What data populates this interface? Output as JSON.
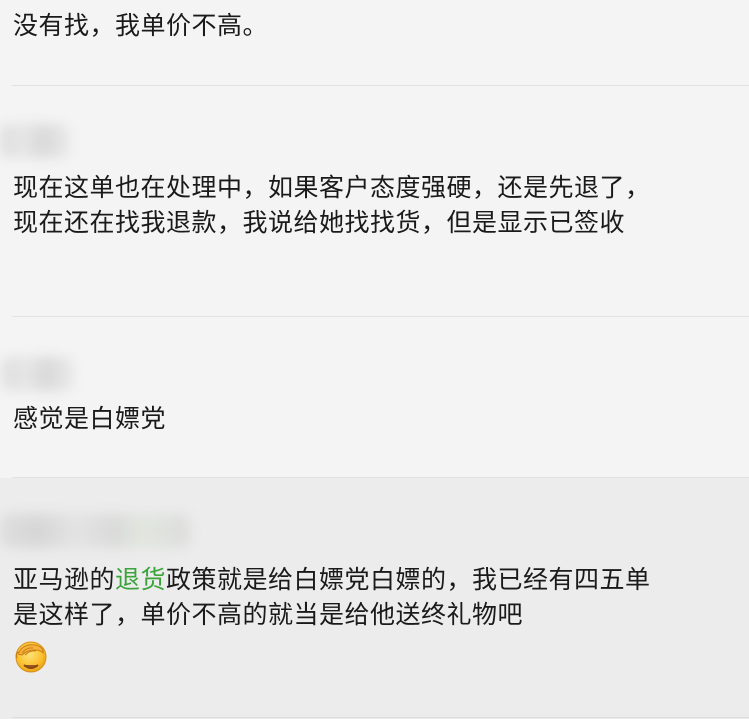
{
  "comments": [
    {
      "text": "没有找，我单价不高。"
    },
    {
      "text": "现在这单也在处理中，如果客户态度强硬，还是先退了，现在还在找我退款，我说给她找找货，但是显示已签收"
    },
    {
      "text": "感觉是白嫖党"
    },
    {
      "text_before_link": "亚马逊的",
      "link_text": "退货",
      "text_after_link": "政策就是给白嫖党白嫖的，我已经有四五单是这样了，单价不高的就当是给他送终礼物吧",
      "emoji": "facepalm-emoji"
    }
  ],
  "colors": {
    "background": "#f3f3f3",
    "text": "#1a1a1a",
    "link": "#3aa33a",
    "divider": "#e2e2e2",
    "highlight_background": "#ececec"
  }
}
